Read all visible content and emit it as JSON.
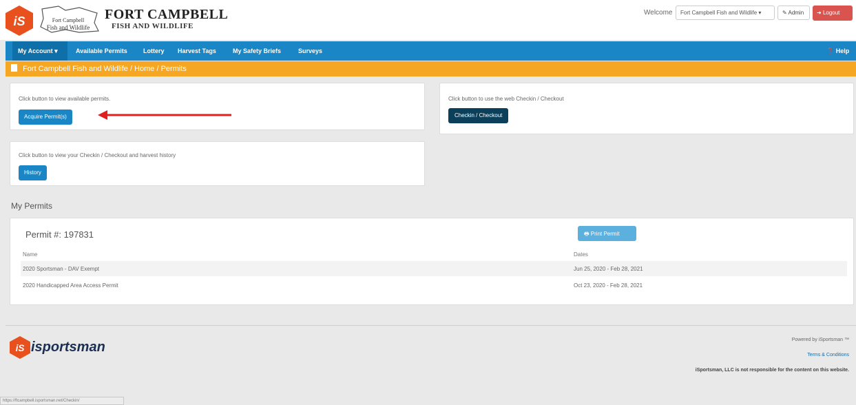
{
  "header": {
    "logo_text": "iS",
    "ms_logo_text": "Fort Campbell Fish and Wildlife",
    "title": "FORT CAMPBELL",
    "subtitle": "FISH AND WILDLIFE",
    "welcome_label": "Welcome",
    "user_dropdown": "Fort Campbell Fish and Wildlife ▾",
    "admin_label": "Admin",
    "logout_label": "Logout"
  },
  "nav": {
    "items": [
      "My Account ▾",
      "Available Permits",
      "Lottery",
      "Harvest Tags",
      "My Safety Briefs",
      "Surveys"
    ],
    "help": "Help"
  },
  "breadcrumb": "Fort Campbell Fish and Wildlife / Home / Permits",
  "panels": {
    "acquire_text": "Click button to view available permits.",
    "acquire_button": "Acquire Permit(s)",
    "checkin_text": "Click button to use the web Checkin / Checkout",
    "checkin_button": "Checkin / Checkout",
    "history_text": "Click button to view your Checkin / Checkout and harvest history",
    "history_button": "History"
  },
  "my_permits": {
    "title": "My Permits",
    "permit_number": "Permit #: 197831",
    "print_button": "Print Permit",
    "columns": [
      "Name",
      "Dates"
    ],
    "rows": [
      {
        "name": "2020 Sportsman - DAV Exempt",
        "dates": "Jun 25, 2020 - Feb 28, 2021"
      },
      {
        "name": "2020 Handicapped Area Access Permit",
        "dates": "Oct 23, 2020 - Feb 28, 2021"
      }
    ]
  },
  "footer": {
    "brand": "isportsman",
    "powered": "Powered by iSportsman ™",
    "terms": "Terms & Conditions",
    "disclaimer": "iSportsman, LLC is not responsible for the content on this website."
  },
  "status_url": "https://ftcampbell.isportsman.net/Checkin/",
  "colors": {
    "nav": "#1a86c5",
    "breadcrumb": "#f5a623",
    "logout": "#d9534f",
    "arrow": "#e02020",
    "logo": "#e8511e"
  }
}
